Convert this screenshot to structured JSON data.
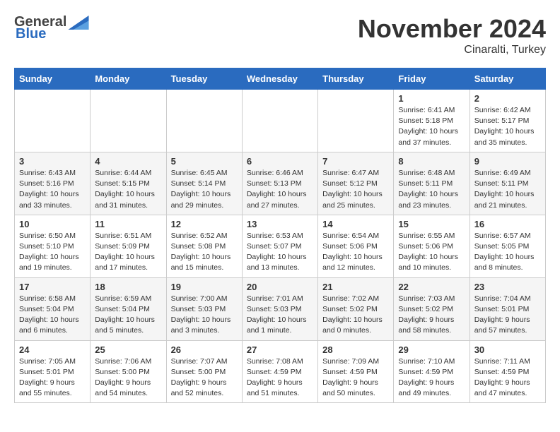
{
  "logo": {
    "general": "General",
    "blue": "Blue"
  },
  "header": {
    "month": "November 2024",
    "location": "Cinaralti, Turkey"
  },
  "days_of_week": [
    "Sunday",
    "Monday",
    "Tuesday",
    "Wednesday",
    "Thursday",
    "Friday",
    "Saturday"
  ],
  "weeks": [
    [
      {
        "day": "",
        "info": ""
      },
      {
        "day": "",
        "info": ""
      },
      {
        "day": "",
        "info": ""
      },
      {
        "day": "",
        "info": ""
      },
      {
        "day": "",
        "info": ""
      },
      {
        "day": "1",
        "info": "Sunrise: 6:41 AM\nSunset: 5:18 PM\nDaylight: 10 hours and 37 minutes."
      },
      {
        "day": "2",
        "info": "Sunrise: 6:42 AM\nSunset: 5:17 PM\nDaylight: 10 hours and 35 minutes."
      }
    ],
    [
      {
        "day": "3",
        "info": "Sunrise: 6:43 AM\nSunset: 5:16 PM\nDaylight: 10 hours and 33 minutes."
      },
      {
        "day": "4",
        "info": "Sunrise: 6:44 AM\nSunset: 5:15 PM\nDaylight: 10 hours and 31 minutes."
      },
      {
        "day": "5",
        "info": "Sunrise: 6:45 AM\nSunset: 5:14 PM\nDaylight: 10 hours and 29 minutes."
      },
      {
        "day": "6",
        "info": "Sunrise: 6:46 AM\nSunset: 5:13 PM\nDaylight: 10 hours and 27 minutes."
      },
      {
        "day": "7",
        "info": "Sunrise: 6:47 AM\nSunset: 5:12 PM\nDaylight: 10 hours and 25 minutes."
      },
      {
        "day": "8",
        "info": "Sunrise: 6:48 AM\nSunset: 5:11 PM\nDaylight: 10 hours and 23 minutes."
      },
      {
        "day": "9",
        "info": "Sunrise: 6:49 AM\nSunset: 5:11 PM\nDaylight: 10 hours and 21 minutes."
      }
    ],
    [
      {
        "day": "10",
        "info": "Sunrise: 6:50 AM\nSunset: 5:10 PM\nDaylight: 10 hours and 19 minutes."
      },
      {
        "day": "11",
        "info": "Sunrise: 6:51 AM\nSunset: 5:09 PM\nDaylight: 10 hours and 17 minutes."
      },
      {
        "day": "12",
        "info": "Sunrise: 6:52 AM\nSunset: 5:08 PM\nDaylight: 10 hours and 15 minutes."
      },
      {
        "day": "13",
        "info": "Sunrise: 6:53 AM\nSunset: 5:07 PM\nDaylight: 10 hours and 13 minutes."
      },
      {
        "day": "14",
        "info": "Sunrise: 6:54 AM\nSunset: 5:06 PM\nDaylight: 10 hours and 12 minutes."
      },
      {
        "day": "15",
        "info": "Sunrise: 6:55 AM\nSunset: 5:06 PM\nDaylight: 10 hours and 10 minutes."
      },
      {
        "day": "16",
        "info": "Sunrise: 6:57 AM\nSunset: 5:05 PM\nDaylight: 10 hours and 8 minutes."
      }
    ],
    [
      {
        "day": "17",
        "info": "Sunrise: 6:58 AM\nSunset: 5:04 PM\nDaylight: 10 hours and 6 minutes."
      },
      {
        "day": "18",
        "info": "Sunrise: 6:59 AM\nSunset: 5:04 PM\nDaylight: 10 hours and 5 minutes."
      },
      {
        "day": "19",
        "info": "Sunrise: 7:00 AM\nSunset: 5:03 PM\nDaylight: 10 hours and 3 minutes."
      },
      {
        "day": "20",
        "info": "Sunrise: 7:01 AM\nSunset: 5:03 PM\nDaylight: 10 hours and 1 minute."
      },
      {
        "day": "21",
        "info": "Sunrise: 7:02 AM\nSunset: 5:02 PM\nDaylight: 10 hours and 0 minutes."
      },
      {
        "day": "22",
        "info": "Sunrise: 7:03 AM\nSunset: 5:02 PM\nDaylight: 9 hours and 58 minutes."
      },
      {
        "day": "23",
        "info": "Sunrise: 7:04 AM\nSunset: 5:01 PM\nDaylight: 9 hours and 57 minutes."
      }
    ],
    [
      {
        "day": "24",
        "info": "Sunrise: 7:05 AM\nSunset: 5:01 PM\nDaylight: 9 hours and 55 minutes."
      },
      {
        "day": "25",
        "info": "Sunrise: 7:06 AM\nSunset: 5:00 PM\nDaylight: 9 hours and 54 minutes."
      },
      {
        "day": "26",
        "info": "Sunrise: 7:07 AM\nSunset: 5:00 PM\nDaylight: 9 hours and 52 minutes."
      },
      {
        "day": "27",
        "info": "Sunrise: 7:08 AM\nSunset: 4:59 PM\nDaylight: 9 hours and 51 minutes."
      },
      {
        "day": "28",
        "info": "Sunrise: 7:09 AM\nSunset: 4:59 PM\nDaylight: 9 hours and 50 minutes."
      },
      {
        "day": "29",
        "info": "Sunrise: 7:10 AM\nSunset: 4:59 PM\nDaylight: 9 hours and 49 minutes."
      },
      {
        "day": "30",
        "info": "Sunrise: 7:11 AM\nSunset: 4:59 PM\nDaylight: 9 hours and 47 minutes."
      }
    ]
  ]
}
